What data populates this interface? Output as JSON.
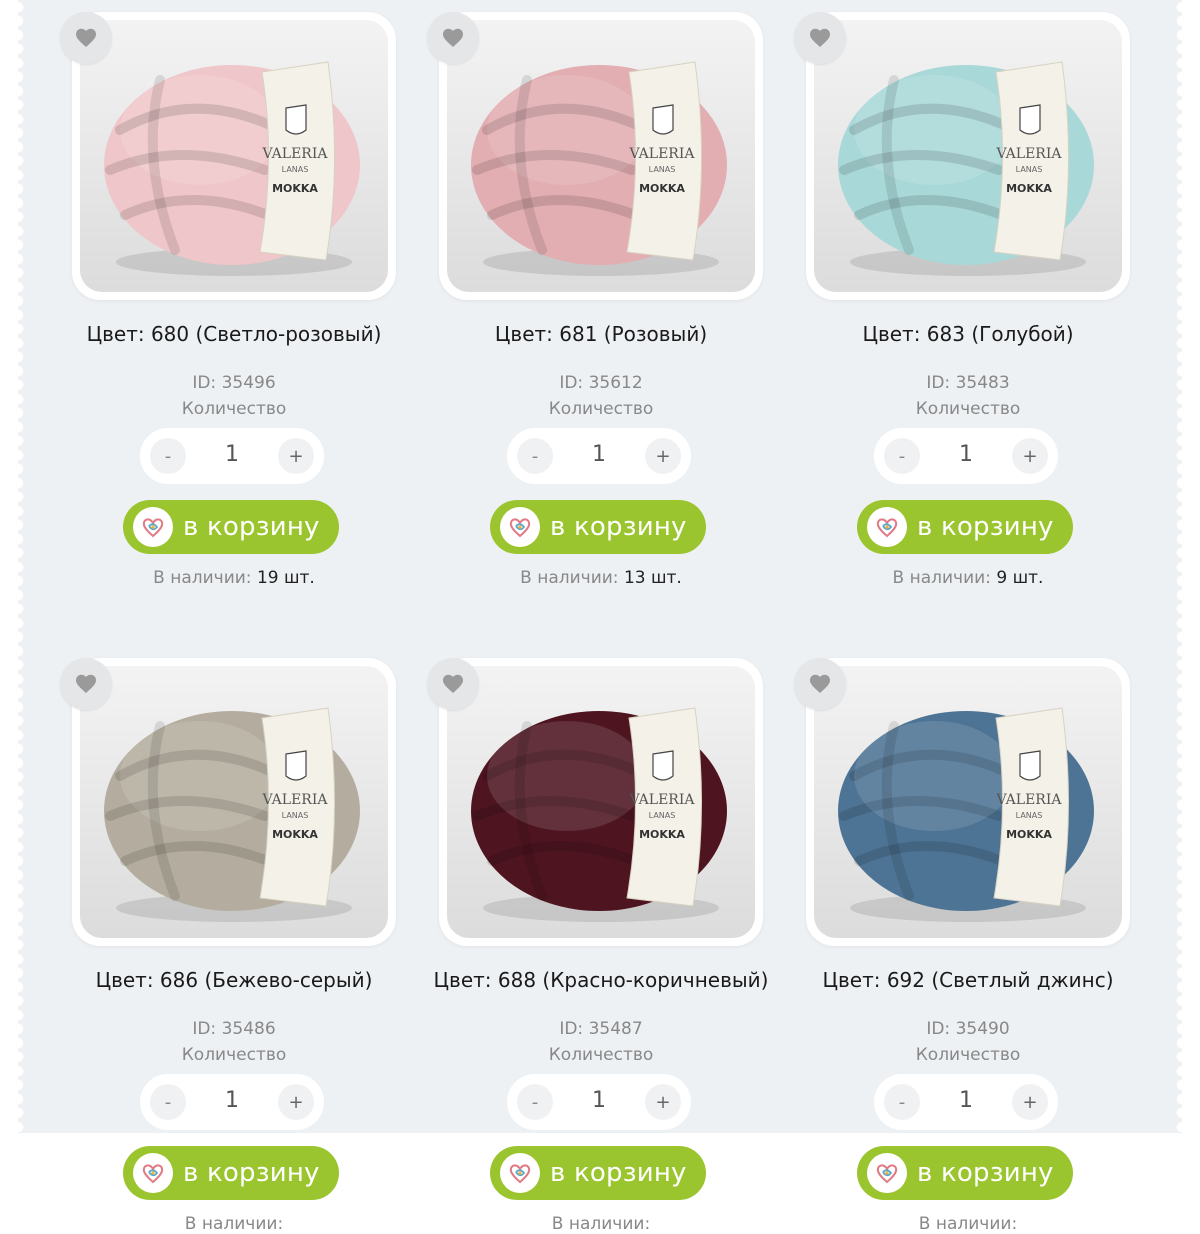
{
  "colors": {
    "accent_green": "#9bc52e",
    "page_bg": "#eef1f4"
  },
  "products": [
    {
      "title": "Цвет: 680 (Светло-розовый)",
      "id_text": "ID: 35496",
      "qty_label": "Количество",
      "qty": "1",
      "cart_label": "в корзину",
      "stock_label": "В наличии:",
      "stock_value": "19 шт.",
      "yarn_color": "#efc6c9",
      "label_brand": "VALERIA",
      "label_sub": "LANAS",
      "label_model": "MOKKA"
    },
    {
      "title": "Цвет: 681 (Розовый)",
      "id_text": "ID: 35612",
      "qty_label": "Количество",
      "qty": "1",
      "cart_label": "в корзину",
      "stock_label": "В наличии:",
      "stock_value": "13 шт.",
      "yarn_color": "#e2aeb2",
      "label_brand": "VALERIA",
      "label_sub": "LANAS",
      "label_model": "MOKKA"
    },
    {
      "title": "Цвет: 683 (Голубой)",
      "id_text": "ID: 35483",
      "qty_label": "Количество",
      "qty": "1",
      "cart_label": "в корзину",
      "stock_label": "В наличии:",
      "stock_value": "9 шт.",
      "yarn_color": "#a9d8d9",
      "label_brand": "VALERIA",
      "label_sub": "LANAS",
      "label_model": "MOKKA"
    },
    {
      "title": "Цвет: 686 (Бежево-серый)",
      "id_text": "ID: 35486",
      "qty_label": "Количество",
      "qty": "1",
      "cart_label": "в корзину",
      "stock_label": "В наличии:",
      "stock_value": "",
      "yarn_color": "#b4ad9f",
      "label_brand": "VALERIA",
      "label_sub": "LANAS",
      "label_model": "MOKKA"
    },
    {
      "title": "Цвет: 688 (Красно-коричневый)",
      "id_text": "ID: 35487",
      "qty_label": "Количество",
      "qty": "1",
      "cart_label": "в корзину",
      "stock_label": "В наличии:",
      "stock_value": "",
      "yarn_color": "#4e1520",
      "label_brand": "VALERIA",
      "label_sub": "LANAS",
      "label_model": "MOKKA"
    },
    {
      "title": "Цвет: 692 (Светлый джинс)",
      "id_text": "ID: 35490",
      "qty_label": "Количество",
      "qty": "1",
      "cart_label": "в корзину",
      "stock_label": "В наличии:",
      "stock_value": "",
      "yarn_color": "#4d7494",
      "label_brand": "VALERIA",
      "label_sub": "LANAS",
      "label_model": "MOKKA"
    }
  ]
}
